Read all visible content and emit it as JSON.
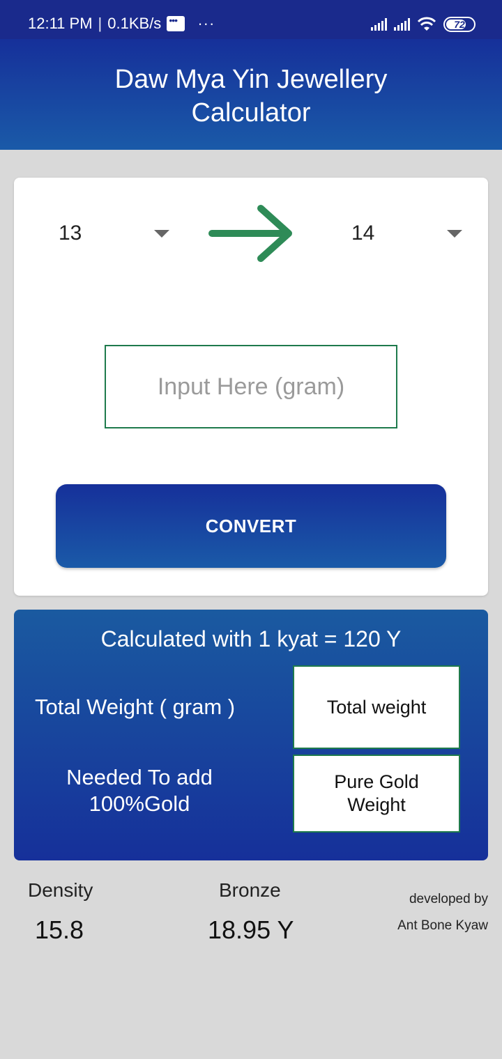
{
  "status_bar": {
    "time": "12:11 PM",
    "speed": "0.1KB/s",
    "more": "···",
    "battery": "72"
  },
  "app": {
    "title_line1": "Daw Mya Yin Jewellery",
    "title_line2": "Calculator"
  },
  "converter": {
    "from_value": "13",
    "to_value": "14",
    "input_placeholder": "Input Here (gram)",
    "input_value": "",
    "convert_label": "CONVERT",
    "arrow_icon": "arrow-right-icon",
    "arrow_color": "#2e8b57"
  },
  "result": {
    "note": "Calculated with 1 kyat = 120 Y",
    "total_label": "Total Weight ( gram )",
    "needed_line1": "Needed To add",
    "needed_line2": "100%Gold",
    "total_output": "Total weight",
    "pure_output_line1": "Pure Gold",
    "pure_output_line2": "Weight"
  },
  "info": {
    "density_label": "Density",
    "density_value": "15.8",
    "bronze_label": "Bronze",
    "bronze_value": "18.95 Y",
    "dev_line1": "developed by",
    "dev_line2": "Ant Bone Kyaw"
  },
  "colors": {
    "primary_dark": "#16309a",
    "primary_light": "#1a5aa8",
    "accent_green": "#1e7a4c",
    "background": "#d9d9d9"
  }
}
